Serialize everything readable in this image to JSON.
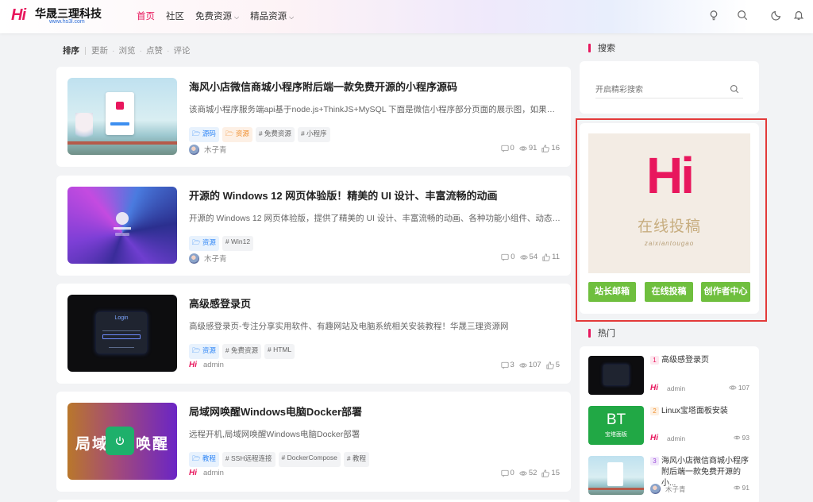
{
  "header": {
    "logo_mark": "Hi",
    "site_name": "华晟三理科技",
    "site_url": "www.hs3l.com",
    "nav": [
      {
        "label": "首页",
        "active": true,
        "dropdown": false
      },
      {
        "label": "社区",
        "active": false,
        "dropdown": false
      },
      {
        "label": "免费资源",
        "active": false,
        "dropdown": true
      },
      {
        "label": "精品资源",
        "active": false,
        "dropdown": true
      }
    ],
    "icons": [
      "lightbulb-icon",
      "search-icon",
      "moon-icon",
      "bell-icon"
    ]
  },
  "sort": {
    "label": "排序",
    "options": [
      "更新",
      "浏览",
      "点赞",
      "评论"
    ]
  },
  "posts": [
    {
      "title": "海风小店微信商城小程序附后端一款免费开源的小程序源码",
      "desc": "该商城小程序服务端api基于node.js+ThinkJS+MySQL 下面是微信小程序部分页面的展示图，如果需要...",
      "tags": [
        {
          "label": "源码",
          "style": "blue",
          "icon": "folder"
        },
        {
          "label": "资源",
          "style": "orange",
          "icon": "folder"
        },
        {
          "label": "# 免费资源",
          "style": "gray",
          "icon": ""
        },
        {
          "label": "# 小程序",
          "style": "gray",
          "icon": ""
        }
      ],
      "author": "木子青",
      "comments": "0",
      "views": "91",
      "likes": "16"
    },
    {
      "title": "开源的 Windows 12 网页体验版！精美的 UI 设计、丰富流畅的动画",
      "desc": "开源的 Windows 12 网页体验版，提供了精美的 UI 设计、丰富流畅的动画、各种功能小组件、动态壁...",
      "tags": [
        {
          "label": "资源",
          "style": "blue",
          "icon": "folder"
        },
        {
          "label": "# Win12",
          "style": "gray",
          "icon": ""
        }
      ],
      "author": "木子青",
      "comments": "0",
      "views": "54",
      "likes": "11"
    },
    {
      "title": "高级感登录页",
      "desc": "高级感登录页-专注分享实用软件、有趣网站及电脑系统相关安装教程！华晟三理资源网",
      "tags": [
        {
          "label": "资源",
          "style": "blue",
          "icon": "folder"
        },
        {
          "label": "# 免费资源",
          "style": "gray",
          "icon": ""
        },
        {
          "label": "# HTML",
          "style": "gray",
          "icon": ""
        }
      ],
      "author": "admin",
      "comments": "3",
      "views": "107",
      "likes": "5"
    },
    {
      "title": "局域网唤醒Windows电脑Docker部署",
      "desc": "远程开机,局域网唤醒Windows电脑Docker部署",
      "tags": [
        {
          "label": "教程",
          "style": "blue",
          "icon": "folder"
        },
        {
          "label": "# SSH远程连接",
          "style": "gray",
          "icon": ""
        },
        {
          "label": "# DockerCompose",
          "style": "gray",
          "icon": ""
        },
        {
          "label": "# 教程",
          "style": "gray",
          "icon": ""
        }
      ],
      "author": "admin",
      "comments": "0",
      "views": "52",
      "likes": "15"
    }
  ],
  "thumbs": {
    "login_text": "Login",
    "wol_text_left": "局域",
    "wol_text_right": "唤醒"
  },
  "sidebar": {
    "search_title": "搜索",
    "search_placeholder": "开启精彩搜索",
    "submission": {
      "logo": "Hi",
      "cn": "在线投稿",
      "en": "zaixiantougao",
      "buttons": [
        "站长邮箱",
        "在线投稿",
        "创作者中心"
      ]
    },
    "hot_title": "热门",
    "hot": [
      {
        "rank": "1",
        "title": "高级感登录页",
        "author": "admin",
        "views": "107"
      },
      {
        "rank": "2",
        "title": "Linux宝塔面板安装",
        "author": "admin",
        "views": "93",
        "thumb_big": "BT",
        "thumb_small": "宝塔面板"
      },
      {
        "rank": "3",
        "title": "海风小店微信商城小程序附后端一款免费开源的小...",
        "author": "木子青",
        "views": "91"
      }
    ]
  },
  "colors": {
    "accent": "#e8175d",
    "green": "#6fbf3e",
    "highlight": "#e33a3a"
  }
}
